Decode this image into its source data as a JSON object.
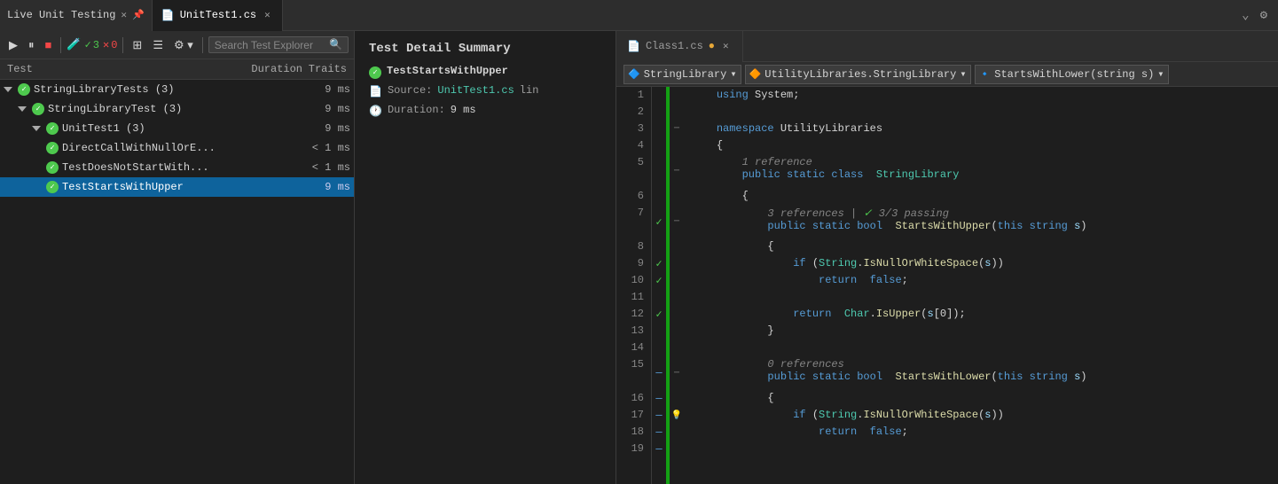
{
  "tabs": {
    "live_unit_testing": "Live Unit Testing",
    "unittest1": "UnitTest1.cs",
    "class1": "Class1.cs"
  },
  "toolbar": {
    "play_label": "▶",
    "pause_label": "⏸",
    "stop_label": "■",
    "test_icon": "🧪",
    "pass_count": "3",
    "fail_count": "0",
    "pass_count2": "3",
    "group_icon": "⊞",
    "settings_icon": "⚙",
    "search_placeholder": "Search Test Explorer",
    "search_icon": "🔍"
  },
  "columns": {
    "test": "Test",
    "duration": "Duration",
    "traits": "Traits"
  },
  "tree": {
    "rows": [
      {
        "indent": 0,
        "expand": "down",
        "name": "StringLibraryTests (3)",
        "duration": "9 ms",
        "has_check": true
      },
      {
        "indent": 1,
        "expand": "down",
        "name": "StringLibraryTest (3)",
        "duration": "9 ms",
        "has_check": true
      },
      {
        "indent": 2,
        "expand": "down",
        "name": "UnitTest1 (3)",
        "duration": "9 ms",
        "has_check": true
      },
      {
        "indent": 3,
        "expand": "none",
        "name": "DirectCallWithNullOrE...",
        "duration": "< 1 ms",
        "has_check": true
      },
      {
        "indent": 3,
        "expand": "none",
        "name": "TestDoesNotStartWith...",
        "duration": "< 1 ms",
        "has_check": true
      },
      {
        "indent": 3,
        "expand": "none",
        "name": "TestStartsWithUpper",
        "duration": "9 ms",
        "has_check": true,
        "selected": true
      }
    ]
  },
  "detail": {
    "title": "Test Detail Summary",
    "test_name": "TestStartsWithUpper",
    "source_label": "Source:",
    "source_file": "UnitTest1.cs",
    "source_suffix": " lin",
    "duration_label": "Duration:",
    "duration_value": "9 ms"
  },
  "editor": {
    "dropdown1_icon": "🔷",
    "dropdown1_label": "StringLibrary",
    "dropdown2_icon": "🔶",
    "dropdown2_label": "UtilityLibraries.StringLibrary",
    "dropdown3_icon": "🔹",
    "dropdown3_label": "StartsWithLower(string s)",
    "lines": [
      {
        "num": 1,
        "fold": "",
        "gutter": "",
        "code": "    <span class='kw'>using</span> <span class='plain'>System;</span>"
      },
      {
        "num": 2,
        "fold": "",
        "gutter": "",
        "code": ""
      },
      {
        "num": 3,
        "fold": "─",
        "gutter": "",
        "code": "    <span class='kw'>namespace</span> <span class='plain'>UtilityLibraries</span>"
      },
      {
        "num": 4,
        "fold": "",
        "gutter": "",
        "code": "    <span class='plain'>{</span>"
      },
      {
        "num": 5,
        "fold": "─",
        "gutter": "",
        "code": "        <span class='hint'>1 reference</span><br><span class='kw'>        public static class</span> <span class='type'>StringLibrary</span>"
      },
      {
        "num": 6,
        "fold": "",
        "gutter": "",
        "code": "        <span class='plain'>{</span>"
      },
      {
        "num": 7,
        "fold": "─",
        "gutter": "✓",
        "code": "            <span class='hint'>3 references | ✅ 3/3 passing</span><br><span class='kw'>            public static bool</span> <span class='method'>StartsWithUpper</span><span class='plain'>(</span><span class='kw'>this string</span><span class='ref'> s</span><span class='plain'>)</span>"
      },
      {
        "num": 8,
        "fold": "",
        "gutter": "",
        "code": "            <span class='plain'>{</span>"
      },
      {
        "num": 9,
        "fold": "",
        "gutter": "✓",
        "code": "                <span class='kw'>if</span> <span class='plain'>(</span><span class='type'>String</span><span class='plain'>.</span><span class='method'>IsNullOrWhiteSpace</span><span class='plain'>(</span><span class='ref'>s</span><span class='plain'>))</span>"
      },
      {
        "num": 10,
        "fold": "",
        "gutter": "✓",
        "code": "                    <span class='kw'>return</span> <span class='kw'>false</span><span class='plain'>;</span>"
      },
      {
        "num": 11,
        "fold": "",
        "gutter": "",
        "code": ""
      },
      {
        "num": 12,
        "fold": "",
        "gutter": "✓",
        "code": "                <span class='kw'>return</span> <span class='type'>Char</span><span class='plain'>.</span><span class='method'>IsUpper</span><span class='plain'>(</span><span class='ref'>s</span><span class='plain'>[0]);</span>"
      },
      {
        "num": 13,
        "fold": "",
        "gutter": "",
        "code": "            <span class='plain'>}</span>"
      },
      {
        "num": 14,
        "fold": "",
        "gutter": "",
        "code": ""
      },
      {
        "num": 15,
        "fold": "─",
        "gutter": "─",
        "code": "            <span class='hint'>0 references</span><br><span class='kw'>            public static bool</span> <span class='method'>StartsWithLower</span><span class='plain'>(</span><span class='kw'>this string</span><span class='ref'> s</span><span class='plain'>)</span>"
      },
      {
        "num": 16,
        "fold": "",
        "gutter": "─",
        "code": "            <span class='plain'>{</span>"
      },
      {
        "num": 17,
        "fold": "",
        "gutter": "─",
        "code": "                <span class='kw'>if</span> <span class='plain'>(</span><span class='type'>String</span><span class='plain'>.</span><span class='method'>IsNullOrWhiteSpace</span><span class='plain'>(</span><span class='ref'>s</span><span class='plain'>))</span>",
        "lightbulb": true
      },
      {
        "num": 18,
        "fold": "",
        "gutter": "─",
        "code": "                    <span class='kw'>return</span> <span class='kw'>false</span><span class='plain'>;</span>"
      },
      {
        "num": 19,
        "fold": "",
        "gutter": "─",
        "code": ""
      }
    ]
  }
}
